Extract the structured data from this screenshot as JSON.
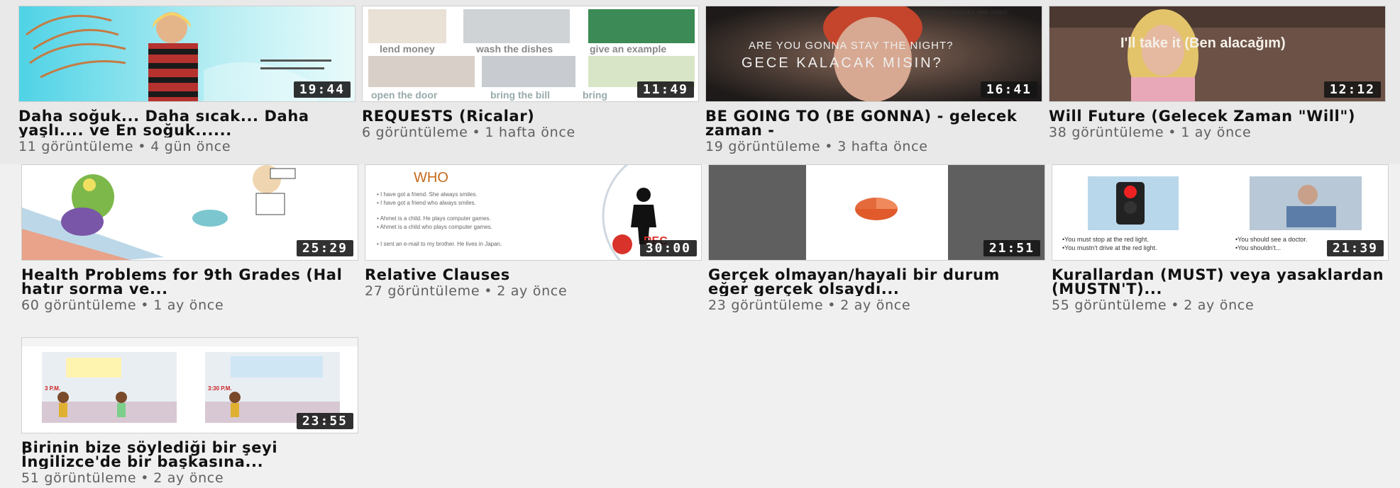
{
  "videos": [
    {
      "title": "Daha soğuk... Daha sıcak... Daha yaşlı.... ve En soğuk......",
      "views": "11 görüntüleme",
      "age": "4 gün önce",
      "duration": "19:44",
      "thumb_text": ""
    },
    {
      "title": "REQUESTS (Ricalar)",
      "views": "6 görüntüleme",
      "age": "1 hafta önce",
      "duration": "11:49",
      "thumb_text": {
        "a": "lend money",
        "b": "wash the dishes",
        "c": "give an example",
        "d": "open the door",
        "e": "bring the bill",
        "f": "bring"
      }
    },
    {
      "title": "BE GOING TO (BE GONNA) - gelecek zaman -",
      "views": "19 görüntüleme",
      "age": "3 hafta önce",
      "duration": "16:41",
      "thumb_text": {
        "a": "ARE YOU GONNA STAY THE NIGHT?",
        "b": "GECE KALACAK MISIN?",
        "c": "Watch Fennaporik's new video!"
      }
    },
    {
      "title": "Will Future (Gelecek Zaman \"Will\")",
      "views": "38 görüntüleme",
      "age": "1 ay önce",
      "duration": "12:12",
      "thumb_text": {
        "a": "I'll take it (Ben alacağım)"
      }
    },
    {
      "title": "Health Problems for 9th Grades (Hal hatır sorma ve...",
      "views": "60 görüntüleme",
      "age": "1 ay önce",
      "duration": "25:29",
      "thumb_text": ""
    },
    {
      "title": "Relative Clauses",
      "views": "27 görüntüleme",
      "age": "2 ay önce",
      "duration": "30:00",
      "thumb_text": {
        "a": "WHO",
        "b": "• I have got a friend. She always smiles.",
        "c": "• I have got a friend who always smiles.",
        "d": "• Ahmet is a child. He plays computer games.",
        "e": "• Ahmet is a child who plays computer games.",
        "f": "• I sent an e-mail to my brother. He lives in Japan.",
        "g": "REC"
      }
    },
    {
      "title": "Gerçek olmayan/hayali bir durum eğer gerçek olsaydı...",
      "views": "23 görüntüleme",
      "age": "2 ay önce",
      "duration": "21:51",
      "thumb_text": ""
    },
    {
      "title": "Kurallardan (MUST) veya yasaklardan (MUSTN'T)...",
      "views": "55 görüntüleme",
      "age": "2 ay önce",
      "duration": "21:39",
      "thumb_text": {
        "a": "•You must stop at the red light.",
        "b": "•You mustn't drive at the red light.",
        "c": "•You should see a doctor.",
        "d": "•You shouldn't..."
      }
    },
    {
      "title": "Birinin bize söylediği bir şeyi İngilizce'de bir başkasına...",
      "views": "51 görüntüleme",
      "age": "2 ay önce",
      "duration": "23:55",
      "thumb_text": {
        "a": "3 P.M.",
        "b": "3:30 P.M."
      }
    }
  ],
  "separator": "•",
  "colors": {
    "background": "#f0f0f0",
    "meta": "#606060",
    "title": "#111111",
    "duration_bg": "#141414"
  }
}
